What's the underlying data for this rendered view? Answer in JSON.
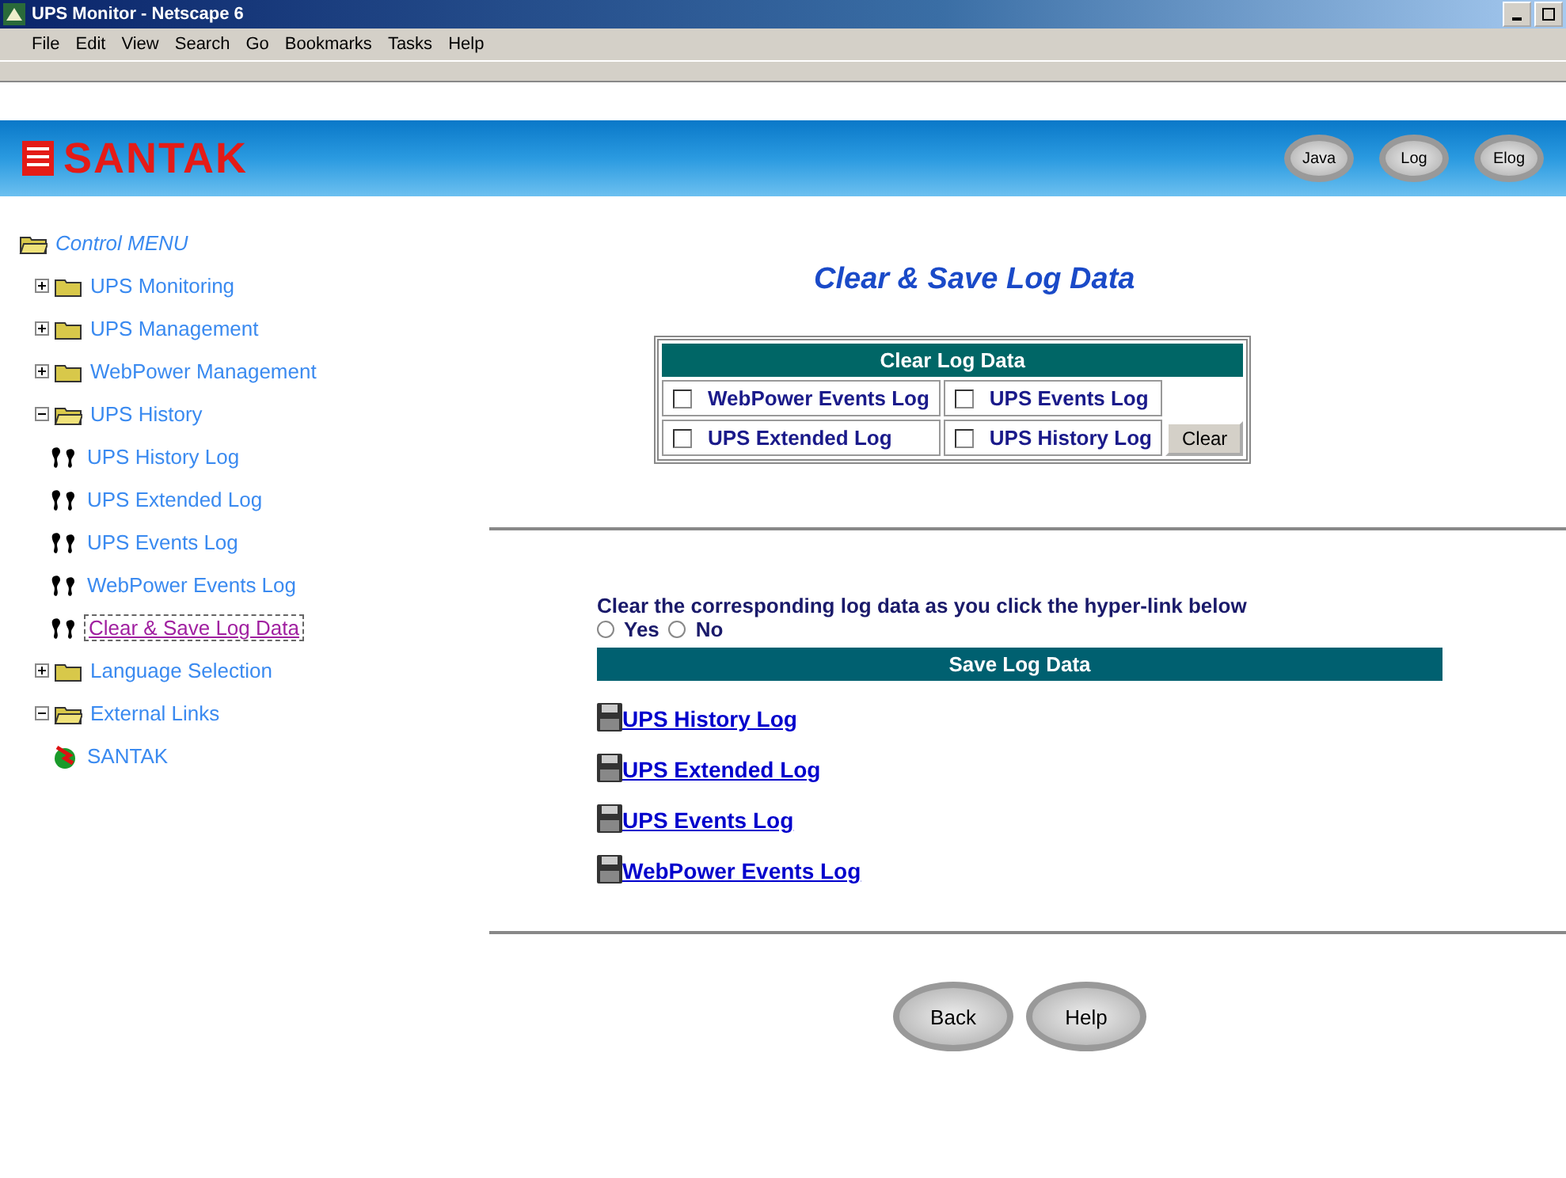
{
  "window": {
    "title": "UPS Monitor - Netscape 6"
  },
  "menu": [
    "File",
    "Edit",
    "View",
    "Search",
    "Go",
    "Bookmarks",
    "Tasks",
    "Help"
  ],
  "banner": {
    "logo": "SANTAK",
    "buttons": [
      "Java",
      "Log",
      "Elog"
    ]
  },
  "tree": {
    "label": "Control MENU",
    "children": [
      {
        "label": "UPS Monitoring",
        "kind": "folder",
        "expanded": false,
        "selected": false
      },
      {
        "label": "UPS Management",
        "kind": "folder",
        "expanded": false,
        "selected": false
      },
      {
        "label": "WebPower Management",
        "kind": "folder",
        "expanded": false,
        "selected": false
      },
      {
        "label": "UPS History",
        "kind": "folder",
        "expanded": true,
        "selected": false,
        "children": [
          {
            "label": "UPS History Log",
            "kind": "page",
            "selected": false
          },
          {
            "label": "UPS Extended Log",
            "kind": "page",
            "selected": false
          },
          {
            "label": "UPS Events Log",
            "kind": "page",
            "selected": false
          },
          {
            "label": "WebPower Events Log",
            "kind": "page",
            "selected": false
          },
          {
            "label": "Clear & Save Log Data",
            "kind": "page",
            "selected": true
          }
        ]
      },
      {
        "label": "Language Selection",
        "kind": "folder",
        "expanded": false,
        "selected": false
      },
      {
        "label": "External Links",
        "kind": "folder",
        "expanded": true,
        "selected": false,
        "children": [
          {
            "label": "SANTAK",
            "kind": "link",
            "selected": false
          }
        ]
      }
    ]
  },
  "page_title": "Clear & Save Log Data",
  "clear_panel": {
    "title": "Clear Log Data",
    "options": [
      {
        "label": "WebPower Events Log",
        "checked": false
      },
      {
        "label": "UPS Events Log",
        "checked": false
      },
      {
        "label": "UPS Extended Log",
        "checked": false
      },
      {
        "label": "UPS History Log",
        "checked": false
      }
    ],
    "button": "Clear"
  },
  "instruction": "Clear the corresponding log data as you click the hyper-link below",
  "radios": [
    {
      "label": "Yes",
      "selected": false
    },
    {
      "label": "No",
      "selected": false
    }
  ],
  "save_panel": {
    "title": "Save Log Data",
    "links": [
      "UPS History Log",
      "UPS Extended Log",
      "UPS Events Log",
      "WebPower Events Log"
    ]
  },
  "footer_buttons": [
    "Back",
    "Help"
  ]
}
